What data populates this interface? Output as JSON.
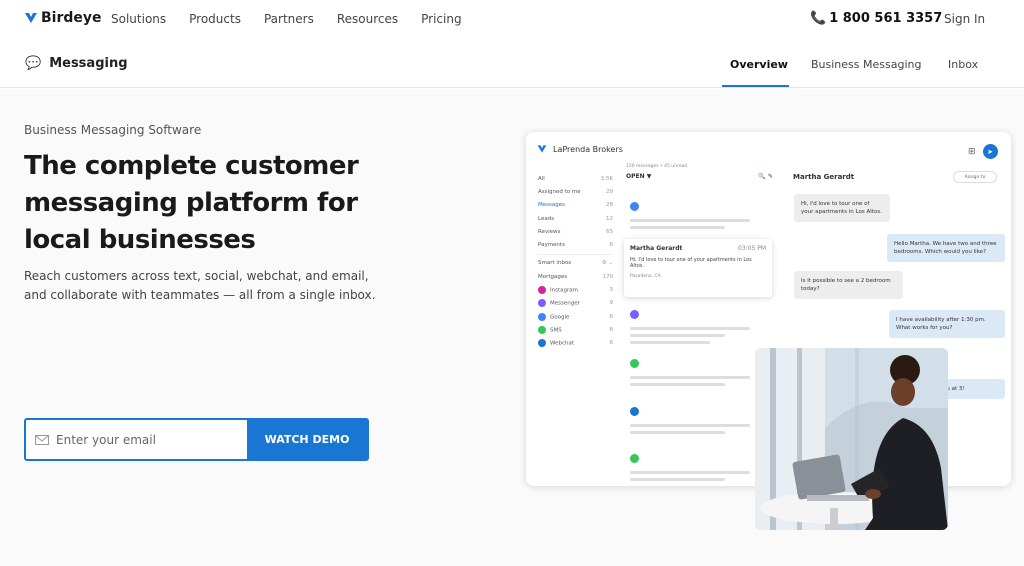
{
  "nav": {
    "logo_text": "Birdeye",
    "links": [
      "Solutions",
      "Products",
      "Partners",
      "Resources",
      "Pricing"
    ],
    "phone": "1 800 561 3357",
    "signin": "Sign In"
  },
  "subnav": {
    "title": "Messaging",
    "tabs": [
      "Overview",
      "Business Messaging",
      "Inbox"
    ]
  },
  "hero": {
    "eyebrow": "Business Messaging Software",
    "headline": "The complete customer messaging platform for local businesses",
    "subcopy": "Reach customers across text, social, webchat, and email, and collaborate with teammates — all from a single inbox.",
    "email_placeholder": "Enter your email",
    "cta": "WATCH DEMO"
  },
  "app": {
    "business": "LaPrenda Brokers",
    "sidebar": [
      {
        "label": "All",
        "count": "3.5K"
      },
      {
        "label": "Assigned to me",
        "count": "29"
      },
      {
        "label": "Messages",
        "count": "28"
      },
      {
        "label": "Leads",
        "count": "12"
      },
      {
        "label": "Reviews",
        "count": "65"
      },
      {
        "label": "Payments",
        "count": "6"
      }
    ],
    "smart_inbox": "Smart inbox",
    "smart_items": [
      {
        "label": "Mortgages",
        "count": "170"
      }
    ],
    "channels": [
      {
        "label": "Instagram",
        "count": "3",
        "color": "#d6249f"
      },
      {
        "label": "Messenger",
        "count": "9",
        "color": "#7b5cff"
      },
      {
        "label": "Google",
        "count": "6",
        "color": "#4285f4"
      },
      {
        "label": "SMS",
        "count": "8",
        "color": "#34c759"
      },
      {
        "label": "Webchat",
        "count": "6",
        "color": "#1976d2"
      }
    ],
    "list_meta": "150 messages • 45 unread",
    "filter": "OPEN",
    "popup": {
      "name": "Martha Gerardt",
      "time": "03:05 PM",
      "text": "Hi, I'd love to tour one of your apartments in Los Altos.",
      "location": "Pasadena, CA"
    },
    "chat": {
      "name": "Martha Gerardt",
      "assign": "Assign to",
      "messages": [
        {
          "dir": "in",
          "text": "Hi, I'd love to tour one of your apartments in Los Altos."
        },
        {
          "dir": "out",
          "text": "Hello Martha. We have two and three bedrooms. Which would you like?"
        },
        {
          "dir": "in",
          "text": "Is it possible to see a 2 bedroom today?"
        },
        {
          "dir": "out",
          "text": "I have availability after 1:30 pm. What works for you?"
        },
        {
          "dir": "out",
          "text": "ou at 3!"
        }
      ]
    }
  }
}
